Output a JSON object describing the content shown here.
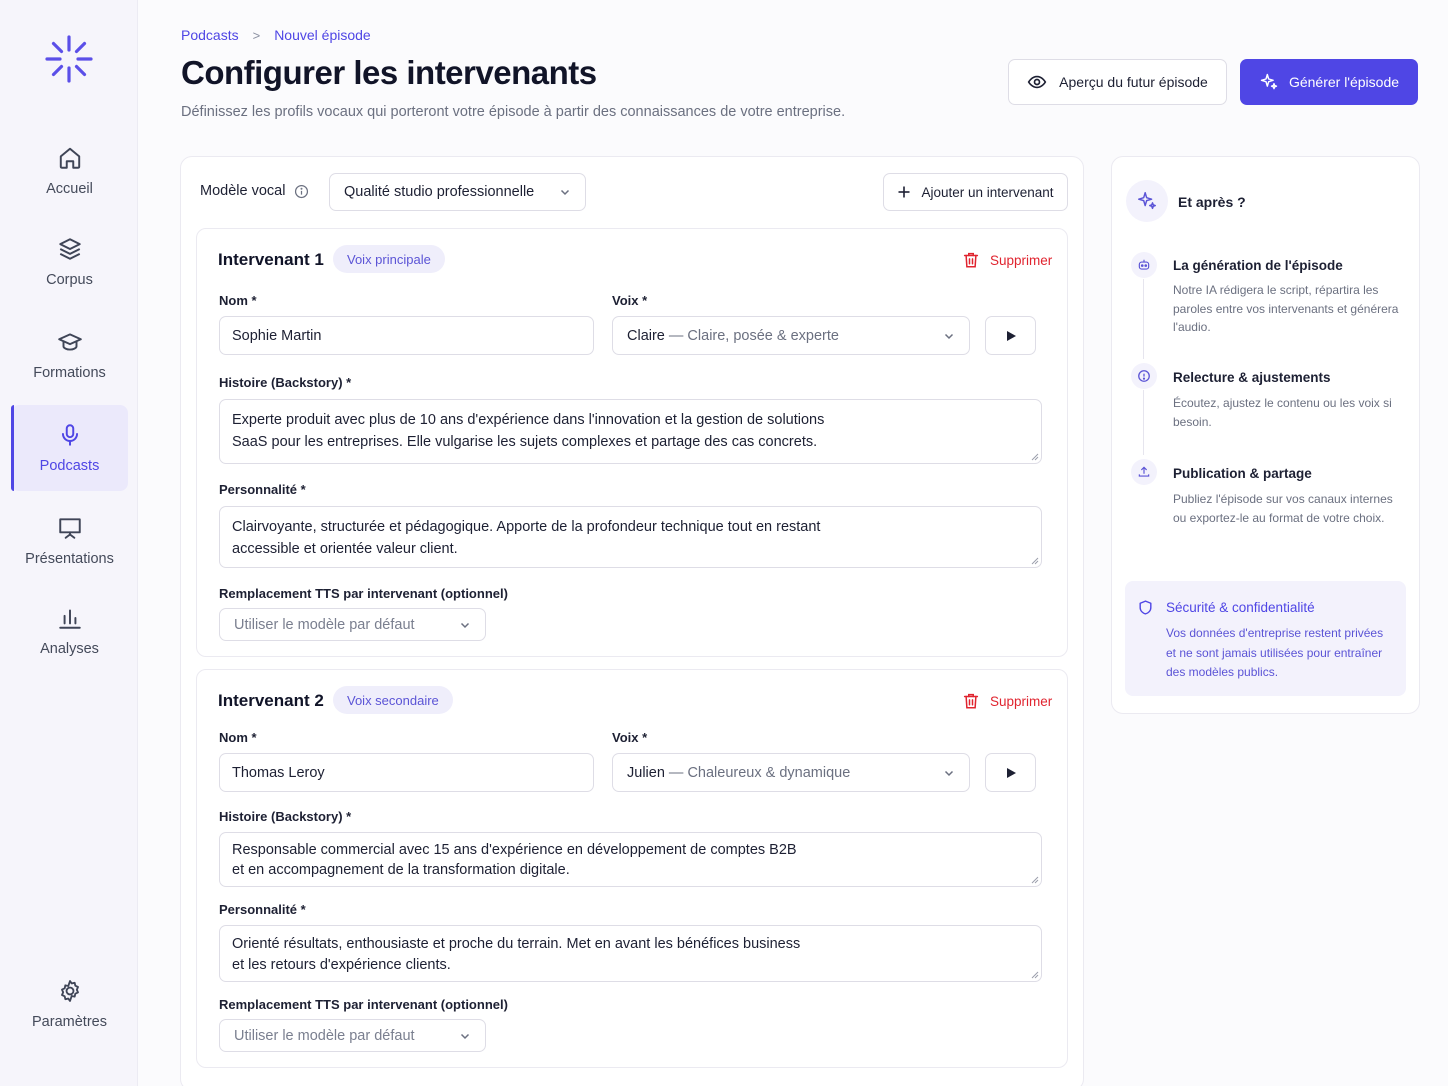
{
  "sidebar": {
    "items": [
      {
        "label": "Accueil",
        "icon": "home-icon"
      },
      {
        "label": "Corpus",
        "icon": "layers-icon"
      },
      {
        "label": "Formations",
        "icon": "graduation-cap-icon"
      },
      {
        "label": "Podcasts",
        "icon": "microphone-icon",
        "active": true
      },
      {
        "label": "Présentations",
        "icon": "presentation-icon"
      },
      {
        "label": "Analyses",
        "icon": "bar-chart-icon"
      }
    ],
    "settings_label": "Paramètres"
  },
  "breadcrumb": {
    "parent": "Podcasts",
    "separator": ">",
    "current": "Nouvel épisode"
  },
  "header": {
    "title": "Configurer les intervenants",
    "subtitle": "Définissez les profils vocaux qui porteront votre épisode à partir des connaissances de votre entreprise.",
    "preview_button": "Aperçu du futur épisode",
    "generate_button": "Générer l'épisode"
  },
  "config": {
    "model_label": "Modèle vocal",
    "model_value": "Qualité studio professionnelle",
    "add_speaker_button": "Ajouter un intervenant"
  },
  "speakers": [
    {
      "title": "Intervenant 1",
      "badge": "Voix principale",
      "delete_label": "Supprimer",
      "name_label": "Nom",
      "name_value": "Sophie Martin",
      "voice_label": "Voix",
      "voice_name": "Claire",
      "voice_desc": "— Claire, posée & experte",
      "backstory_label": "Histoire (Backstory)",
      "backstory_line1": "Experte produit avec plus de 10 ans d'expérience dans l'innovation et la gestion de solutions",
      "backstory_line2": "SaaS pour les entreprises. Elle vulgarise les sujets complexes et partage des cas concrets.",
      "personality_label": "Personnalité",
      "personality_line1": "Clairvoyante, structurée et pédagogique. Apporte de la profondeur technique tout en restant",
      "personality_line2": "accessible et orientée valeur client.",
      "tts_label": "Remplacement TTS par intervenant (optionnel)",
      "tts_value": "Utiliser le modèle par défaut",
      "required_mark": "*"
    },
    {
      "title": "Intervenant 2",
      "badge": "Voix secondaire",
      "delete_label": "Supprimer",
      "name_label": "Nom",
      "name_value": "Thomas Leroy",
      "voice_label": "Voix",
      "voice_name": "Julien",
      "voice_desc": "— Chaleureux & dynamique",
      "backstory_label": "Histoire (Backstory)",
      "backstory_line1": "Responsable commercial avec 15 ans d'expérience en développement de comptes B2B",
      "backstory_line2": "et en accompagnement de la transformation digitale.",
      "personality_label": "Personnalité",
      "personality_line1": "Orienté résultats, enthousiaste et proche du terrain. Met en avant les bénéfices business",
      "personality_line2": "et les retours d'expérience clients.",
      "tts_label": "Remplacement TTS par intervenant (optionnel)",
      "tts_value": "Utiliser le modèle par défaut",
      "required_mark": "*"
    }
  ],
  "next_steps": {
    "heading": "Et après ?",
    "steps": [
      {
        "title": "La génération de l'épisode",
        "desc": "Notre IA rédigera le script, répartira les paroles entre vos intervenants et générera l'audio.",
        "icon": "robot-icon"
      },
      {
        "title": "Relecture & ajustements",
        "desc": "Écoutez, ajustez le contenu ou les voix si besoin.",
        "icon": "info-circle-icon"
      },
      {
        "title": "Publication & partage",
        "desc": "Publiez l'épisode sur vos canaux internes ou exportez-le au format de votre choix.",
        "icon": "share-icon"
      }
    ],
    "security_title": "Sécurité & confidentialité",
    "security_desc": "Vos données d'entreprise restent privées et ne sont jamais utilisées pour entraîner des modèles publics."
  },
  "colors": {
    "accent": "#4f46e5",
    "danger": "#e0242f",
    "sidebar_bg": "#f6f5fb",
    "badge_bg": "#efeefb"
  }
}
